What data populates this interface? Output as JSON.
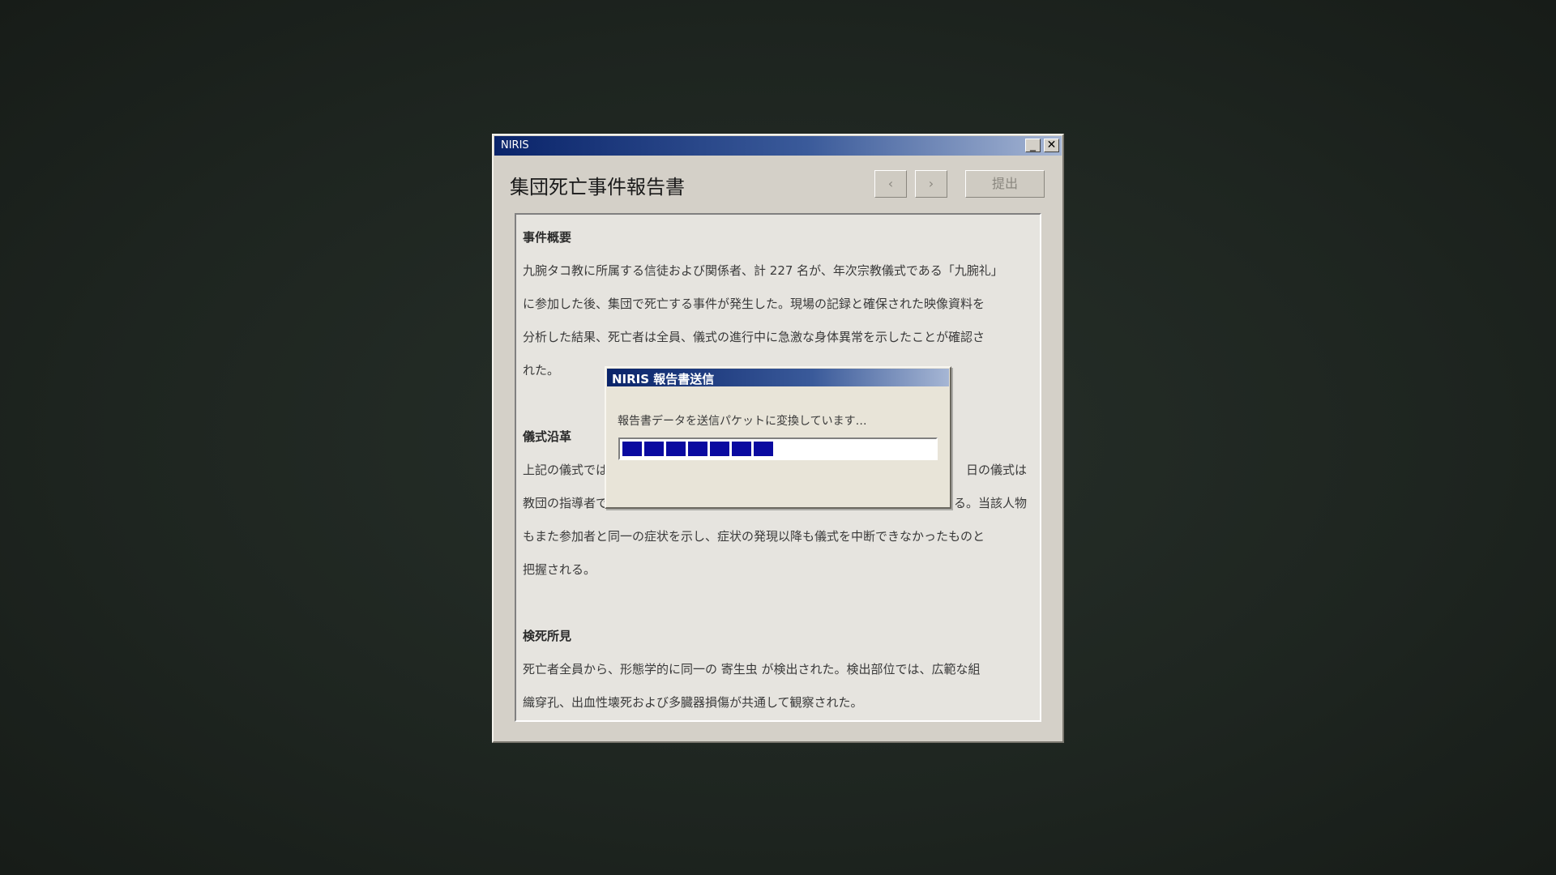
{
  "window": {
    "title": "NIRIS",
    "minimize_glyph": "_",
    "close_glyph": "✕"
  },
  "header": {
    "title": "集団死亡事件報告書",
    "prev_label": "‹",
    "next_label": "›",
    "submit_label": "提出"
  },
  "document": {
    "sections": [
      {
        "heading": "事件概要",
        "lines": [
          "九腕タコ教に所属する信徒および関係者、計 227 名が、年次宗教儀式である「九腕礼」",
          "に参加した後、集団で死亡する事件が発生した。現場の記録と確保された映像資料を",
          "分析した結果、死亡者は全員、儀式の進行中に急激な身体異常を示したことが確認さ",
          "れた。"
        ]
      },
      {
        "heading": "儀式沿革",
        "lines": [
          "上記の儀式では",
          "教団の指導者で",
          "もまた参加者と同一の症状を示し、症状の発現以降も儀式を中断できなかったものと",
          "把握される。"
        ],
        "partial_right": [
          "日の儀式は",
          "る。当該人物"
        ]
      },
      {
        "heading": "検死所見",
        "lines": [
          "死亡者全員から、形態学的に同一の 寄生虫 が検出された。検出部位では、広範な組",
          "織穿孔、出血性壊死および多臓器損傷が共通して観察された。"
        ]
      }
    ]
  },
  "dialog": {
    "title": "NIRIS 報告書送信",
    "message": "報告書データを送信パケットに変換しています…",
    "progress_blocks": 7,
    "progress_fraction": 0.5,
    "progress_color": "#0a0aa0"
  }
}
